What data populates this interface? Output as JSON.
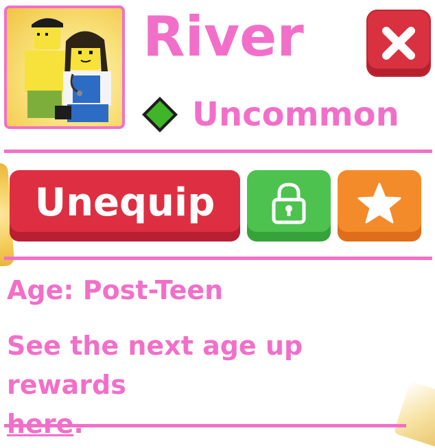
{
  "pet": {
    "name": "River",
    "rarity": "Uncommon",
    "rarity_color": "#3fb527"
  },
  "buttons": {
    "close_icon": "close-icon",
    "unequip_label": "Unequip",
    "lock_icon": "lock-icon",
    "favorite_icon": "star-icon"
  },
  "info": {
    "age_line": "Age: Post-Teen",
    "rewards_prefix": "See the next age up rewards",
    "rewards_link": "here",
    "rewards_suffix": "."
  },
  "colors": {
    "accent": "#f26fc9",
    "close": "#d9313f",
    "unequip": "#dd2f41",
    "lock": "#4dc24f",
    "favorite": "#f48b2a"
  }
}
